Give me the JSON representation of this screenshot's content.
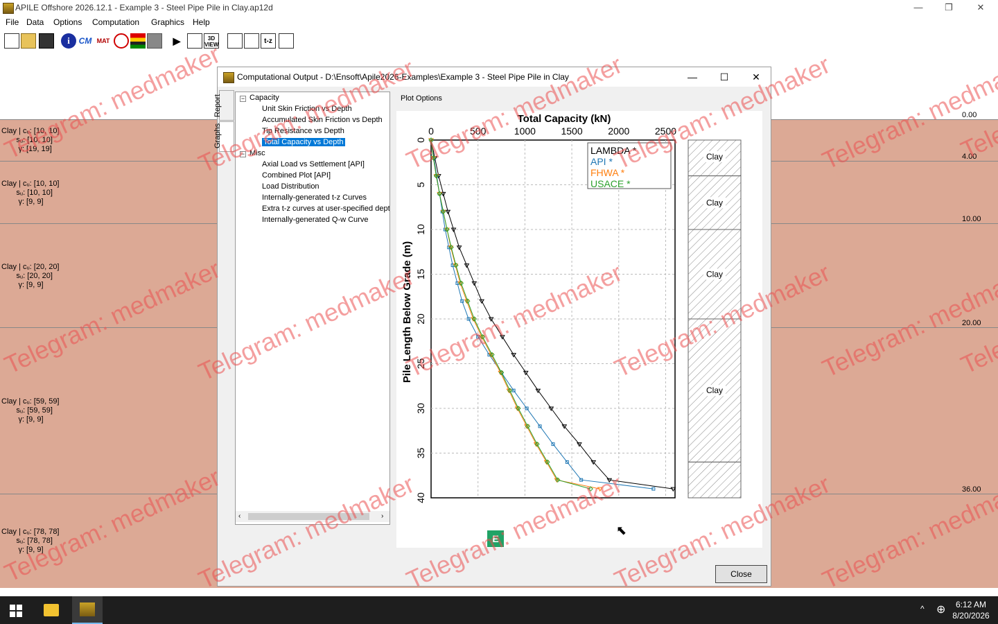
{
  "app": {
    "title": "APILE Offshore 2026.12.1 - Example 3 - Steel Pipe Pile in Clay.ap12d",
    "minimize": "—",
    "restore": "❐",
    "close": "✕"
  },
  "menu": [
    "File",
    "Data",
    "Options",
    "Computation",
    "Graphics",
    "Help"
  ],
  "toolbar": [
    {
      "icon": "new-file-icon",
      "label": ""
    },
    {
      "icon": "open-folder-icon",
      "label": ""
    },
    {
      "icon": "save-icon",
      "label": ""
    },
    {
      "icon": "info-icon",
      "label": "i"
    },
    {
      "icon": "cm-icon",
      "label": "CM"
    },
    {
      "icon": "mat-icon",
      "label": "MAT"
    },
    {
      "icon": "circle-section-icon",
      "label": ""
    },
    {
      "icon": "soil-layers-icon",
      "label": ""
    },
    {
      "icon": "grid-icon",
      "label": ""
    },
    {
      "icon": "run-icon",
      "label": "▶"
    },
    {
      "icon": "report-icon",
      "label": ""
    },
    {
      "icon": "3d-view-icon",
      "label": "3D VIEW"
    },
    {
      "icon": "tabular-input-icon",
      "label": ""
    },
    {
      "icon": "p-y-curve-icon",
      "label": ""
    },
    {
      "icon": "t-z-icon",
      "label": "t-z"
    },
    {
      "icon": "q-w-curve-icon",
      "label": ""
    }
  ],
  "layers": [
    {
      "lines": [
        "Clay | cᵤ: [10, 10]",
        "       sᵤ: [10, 10]",
        "        γ: [19, 19]"
      ],
      "depth": "0.00"
    },
    {
      "lines": [
        "Clay | cᵤ: [10, 10]",
        "       sᵤ: [10, 10]",
        "        γ: [9, 9]"
      ],
      "depth": "4.00"
    },
    {
      "lines": [
        "Clay | cᵤ: [20, 20]",
        "       sᵤ: [20, 20]",
        "        γ: [9, 9]"
      ],
      "depth": "10.00"
    },
    {
      "lines": [
        "Clay | cᵤ: [59, 59]",
        "       sᵤ: [59, 59]",
        "        γ: [9, 9]"
      ],
      "depth": "20.00"
    },
    {
      "lines": [
        "Clay | cᵤ: [78, 78]",
        "       sᵤ: [78, 78]",
        "        γ: [9, 9]"
      ],
      "depth": "36.00"
    }
  ],
  "dialog": {
    "title": "Computational Output - D:\\Ensoft\\Apile2026-Examples\\Example 3 - Steel Pipe Pile in Clay",
    "tabs": [
      "Report",
      "Graphs"
    ],
    "plot_options": "Plot Options",
    "close_button": "Close",
    "tree": {
      "groups": [
        {
          "label": "Capacity",
          "items": [
            "Unit Skin Friction vs Depth",
            "Accumulated Skin Friction vs Depth",
            "Tip Resistance vs Depth",
            "Total Capacity vs Depth"
          ]
        },
        {
          "label": "Misc",
          "items": [
            "Axial Load vs Settlement [API]",
            "Combined Plot [API]",
            "Load Distribution",
            "Internally-generated t-z Curves",
            "Extra t-z curves at user-specified depth",
            "Internally-generated Q-w Curve"
          ]
        }
      ],
      "selected": "Total Capacity vs Depth",
      "expander": "−"
    },
    "excel_badge": "E"
  },
  "chart_data": {
    "type": "line",
    "title": "Total Capacity (kN)",
    "xlabel": "Total Capacity (kN)",
    "ylabel": "Pile Length Below Grade (m)",
    "xlim": [
      0,
      2600
    ],
    "ylim": [
      0,
      40
    ],
    "y_inverted": true,
    "xticks": [
      0,
      500,
      1000,
      1500,
      2000,
      2500
    ],
    "yticks": [
      0,
      5,
      10,
      15,
      20,
      25,
      30,
      35,
      40
    ],
    "grid": true,
    "legend_position": "top-right",
    "series": [
      {
        "name": "LAMBDA *",
        "color": "#000000",
        "marker": "tri",
        "points": [
          [
            0,
            0
          ],
          [
            40,
            2
          ],
          [
            80,
            4
          ],
          [
            130,
            6
          ],
          [
            180,
            8
          ],
          [
            240,
            10
          ],
          [
            300,
            12
          ],
          [
            380,
            14
          ],
          [
            460,
            16
          ],
          [
            540,
            18
          ],
          [
            640,
            20
          ],
          [
            760,
            22
          ],
          [
            880,
            24
          ],
          [
            1010,
            26
          ],
          [
            1140,
            28
          ],
          [
            1280,
            30
          ],
          [
            1420,
            32
          ],
          [
            1580,
            34
          ],
          [
            1730,
            36
          ],
          [
            1900,
            38
          ],
          [
            2580,
            39
          ]
        ]
      },
      {
        "name": "API *",
        "color": "#1f77b4",
        "marker": "square",
        "points": [
          [
            0,
            0
          ],
          [
            30,
            2
          ],
          [
            60,
            4
          ],
          [
            90,
            6
          ],
          [
            120,
            8
          ],
          [
            150,
            10
          ],
          [
            190,
            12
          ],
          [
            230,
            14
          ],
          [
            280,
            16
          ],
          [
            330,
            18
          ],
          [
            400,
            20
          ],
          [
            500,
            22
          ],
          [
            620,
            24
          ],
          [
            750,
            26
          ],
          [
            880,
            28
          ],
          [
            1020,
            30
          ],
          [
            1160,
            32
          ],
          [
            1300,
            34
          ],
          [
            1450,
            36
          ],
          [
            1600,
            38
          ],
          [
            2370,
            39
          ]
        ]
      },
      {
        "name": "FHWA *",
        "color": "#ff7f0e",
        "marker": "tri",
        "points": [
          [
            0,
            0
          ],
          [
            25,
            2
          ],
          [
            55,
            4
          ],
          [
            90,
            6
          ],
          [
            130,
            8
          ],
          [
            170,
            10
          ],
          [
            210,
            12
          ],
          [
            260,
            14
          ],
          [
            310,
            16
          ],
          [
            380,
            18
          ],
          [
            450,
            20
          ],
          [
            540,
            22
          ],
          [
            640,
            24
          ],
          [
            740,
            26
          ],
          [
            830,
            28
          ],
          [
            920,
            30
          ],
          [
            1020,
            32
          ],
          [
            1120,
            34
          ],
          [
            1230,
            36
          ],
          [
            1340,
            38
          ],
          [
            1800,
            39
          ]
        ]
      },
      {
        "name": "USACE *",
        "color": "#2ca02c",
        "marker": "diamond",
        "points": [
          [
            0,
            0
          ],
          [
            25,
            2
          ],
          [
            55,
            4
          ],
          [
            90,
            6
          ],
          [
            130,
            8
          ],
          [
            170,
            10
          ],
          [
            215,
            12
          ],
          [
            265,
            14
          ],
          [
            320,
            16
          ],
          [
            390,
            18
          ],
          [
            460,
            20
          ],
          [
            550,
            22
          ],
          [
            650,
            24
          ],
          [
            750,
            26
          ],
          [
            840,
            28
          ],
          [
            930,
            30
          ],
          [
            1030,
            32
          ],
          [
            1130,
            34
          ],
          [
            1240,
            36
          ],
          [
            1350,
            38
          ],
          [
            1700,
            39
          ]
        ]
      }
    ],
    "soil_column": {
      "depth_max": 40,
      "layers": [
        {
          "label": "Clay",
          "top": 0,
          "bottom": 4
        },
        {
          "label": "Clay",
          "top": 4,
          "bottom": 10
        },
        {
          "label": "Clay",
          "top": 10,
          "bottom": 20
        },
        {
          "label": "Clay",
          "top": 20,
          "bottom": 36
        },
        {
          "label": "",
          "top": 36,
          "bottom": 40
        }
      ]
    }
  },
  "taskbar": {
    "time": "6:12 AM",
    "date": "8/20/2026"
  },
  "watermark": "Telegram: medmaker"
}
